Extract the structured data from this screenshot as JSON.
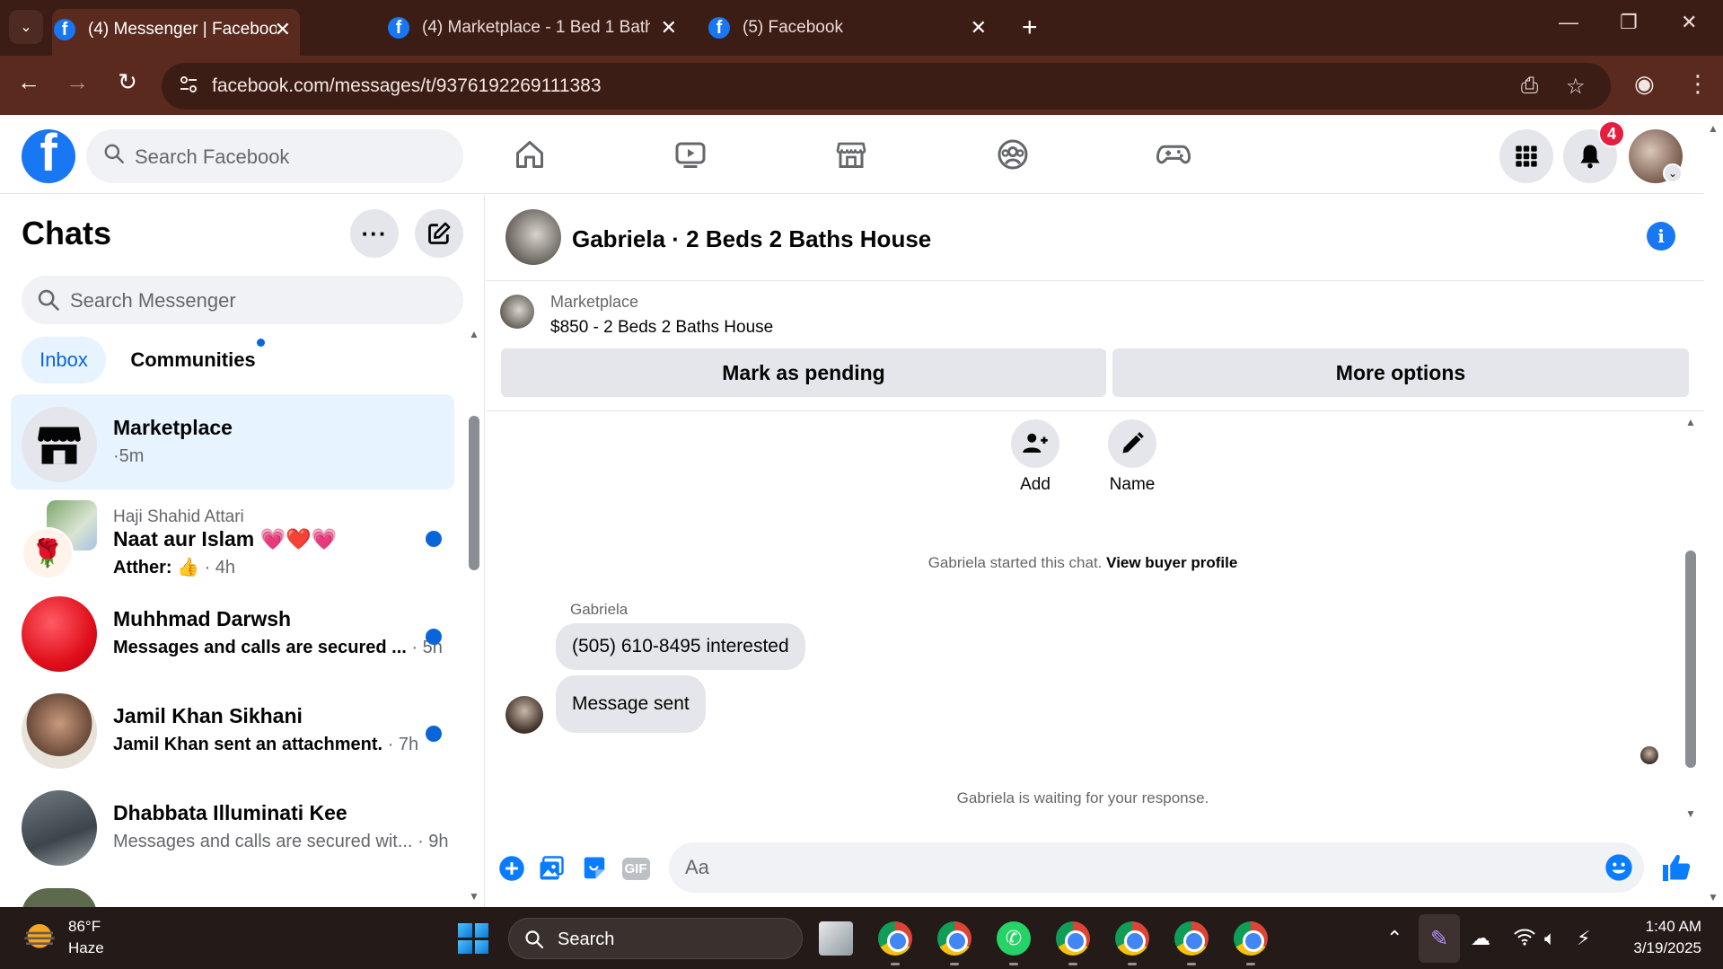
{
  "browser": {
    "tabs": [
      {
        "title": "(4) Messenger | Facebook",
        "active": true
      },
      {
        "title": "(4) Marketplace - 1 Bed 1 Bath |",
        "active": false
      },
      {
        "title": "(5) Facebook",
        "active": false
      }
    ],
    "url": "facebook.com/messages/t/9376192269111383"
  },
  "fb_header": {
    "search_placeholder": "Search Facebook",
    "notification_count": "4"
  },
  "sidebar": {
    "title": "Chats",
    "search_placeholder": "Search Messenger",
    "filters": {
      "inbox": "Inbox",
      "communities": "Communities"
    },
    "chats": [
      {
        "name": "Marketplace",
        "preview": "",
        "time": "·5m",
        "unread": false,
        "selected": true
      },
      {
        "small": "Haji Shahid Attari",
        "name": "Naat aur Islam 💗❤️💗",
        "preview_sender": "Atther:",
        "preview": "👍",
        "time": "· 4h",
        "unread": true
      },
      {
        "name": "Muhhmad Darwsh",
        "preview": "Messages and calls are secured ...",
        "time": "· 5h",
        "unread": true
      },
      {
        "name": "Jamil Khan Sikhani",
        "preview": "Jamil Khan sent an attachment.",
        "time": "· 7h",
        "unread": true
      },
      {
        "name": "Dhabbata Illuminati Kee",
        "preview": "Messages and calls are secured wit...",
        "time": "· 9h",
        "unread": false
      }
    ]
  },
  "conversation": {
    "title": "Gabriela · 2 Beds 2 Baths House",
    "marketplace_label": "Marketplace",
    "listing": "$850 - 2 Beds 2 Baths House",
    "mark_pending": "Mark as pending",
    "more_options": "More options",
    "actions": {
      "add": "Add",
      "name": "Name"
    },
    "started_text": "Gabriela started this chat.",
    "view_profile": "View buyer profile",
    "sender": "Gabriela",
    "messages": [
      "(505) 610-8495 interested",
      "Message sent"
    ],
    "waiting_text": "Gabriela is waiting for your response.",
    "composer_placeholder": "Aa"
  },
  "taskbar": {
    "weather_temp": "86°F",
    "weather_desc": "Haze",
    "search_placeholder": "Search",
    "time": "1:40 AM",
    "date": "3/19/2025"
  }
}
